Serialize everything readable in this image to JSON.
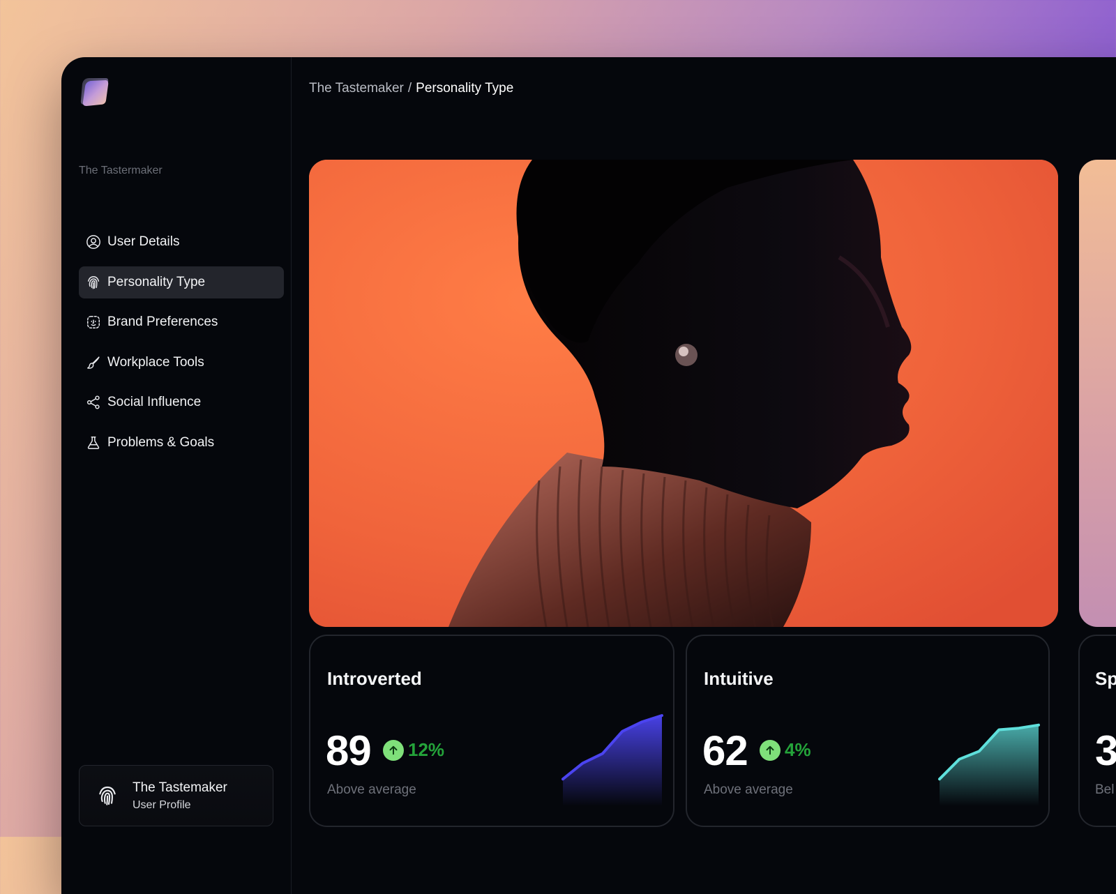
{
  "sidebar": {
    "section_title": "The Tastermaker",
    "items": [
      {
        "label": "User Details",
        "icon": "user-circle-icon",
        "active": false
      },
      {
        "label": "Personality Type",
        "icon": "fingerprint-icon",
        "active": true
      },
      {
        "label": "Brand Preferences",
        "icon": "scan-face-icon",
        "active": false
      },
      {
        "label": "Workplace Tools",
        "icon": "brush-icon",
        "active": false
      },
      {
        "label": "Social Influence",
        "icon": "share-icon",
        "active": false
      },
      {
        "label": "Problems & Goals",
        "icon": "flask-icon",
        "active": false
      }
    ],
    "profile": {
      "name": "The Tastemaker",
      "subtitle": "User Profile",
      "icon": "fingerprint-icon"
    }
  },
  "breadcrumb": {
    "parent": "The Tastemaker",
    "separator": "/",
    "current": "Personality Type"
  },
  "hero": {
    "image": "profile portrait on orange background"
  },
  "stats": [
    {
      "label": "Introverted",
      "value": "89",
      "delta": "12%",
      "note": "Above average",
      "color": "#4b44f0",
      "trend": [
        20,
        40,
        52,
        80,
        92,
        100
      ]
    },
    {
      "label": "Intuitive",
      "value": "62",
      "delta": "4%",
      "note": "Above average",
      "color": "#5fe0dc",
      "trend": [
        20,
        45,
        55,
        82,
        84,
        88
      ]
    },
    {
      "label": "Sp",
      "value": "3",
      "note": "Bel"
    }
  ]
}
